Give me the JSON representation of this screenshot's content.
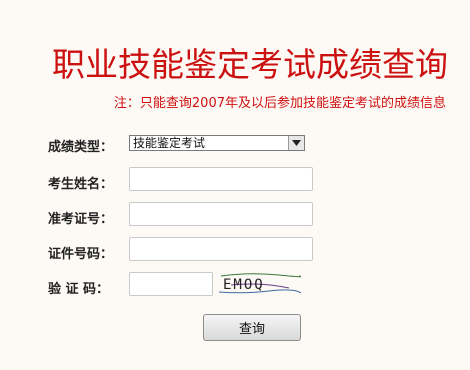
{
  "header": {
    "title": "职业技能鉴定考试成绩查询",
    "note": "注：只能查询2007年及以后参加技能鉴定考试的成绩信息"
  },
  "form": {
    "score_type_label": "成绩类型：",
    "score_type_value": "技能鉴定考试",
    "name_label": "考生姓名：",
    "exam_number_label": "准考证号：",
    "id_number_label": "证件号码：",
    "captcha_label": "验 证 码：",
    "captcha_text": "EMOQ",
    "submit_label": "查询"
  },
  "colors": {
    "accent": "#cc1111",
    "background": "#fdfaf6"
  }
}
